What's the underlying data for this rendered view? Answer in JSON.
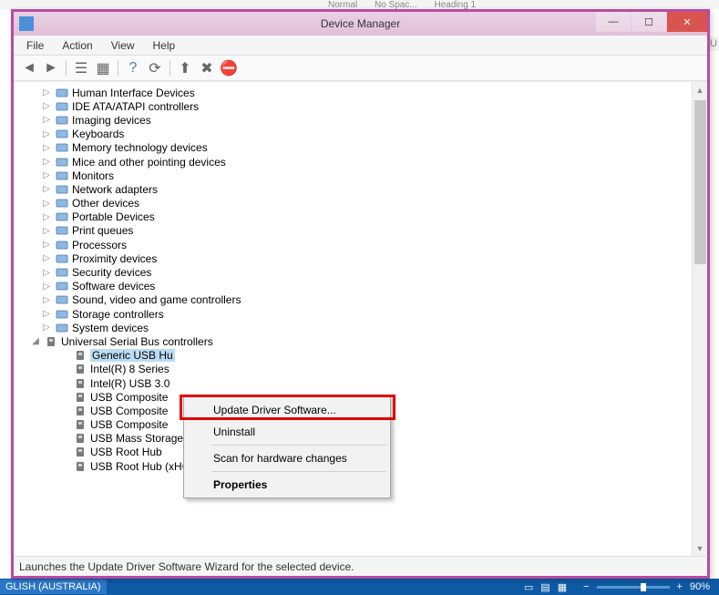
{
  "background": {
    "ribbon_fragments": [
      "Normal",
      "No Spac...",
      "Heading 1"
    ],
    "lang": "GLISH (AUSTRALIA)",
    "zoom": "90%",
    "su_frag": "SU"
  },
  "window": {
    "title": "Device Manager"
  },
  "menubar": {
    "file": "File",
    "action": "Action",
    "view": "View",
    "help": "Help"
  },
  "tree": {
    "items": [
      {
        "label": "Human Interface Devices",
        "icon": "hid"
      },
      {
        "label": "IDE ATA/ATAPI controllers",
        "icon": "ide"
      },
      {
        "label": "Imaging devices",
        "icon": "imaging"
      },
      {
        "label": "Keyboards",
        "icon": "keyboard"
      },
      {
        "label": "Memory technology devices",
        "icon": "memory"
      },
      {
        "label": "Mice and other pointing devices",
        "icon": "mouse"
      },
      {
        "label": "Monitors",
        "icon": "monitor"
      },
      {
        "label": "Network adapters",
        "icon": "network"
      },
      {
        "label": "Other devices",
        "icon": "other"
      },
      {
        "label": "Portable Devices",
        "icon": "portable"
      },
      {
        "label": "Print queues",
        "icon": "printer"
      },
      {
        "label": "Processors",
        "icon": "cpu"
      },
      {
        "label": "Proximity devices",
        "icon": "prox"
      },
      {
        "label": "Security devices",
        "icon": "security"
      },
      {
        "label": "Software devices",
        "icon": "software"
      },
      {
        "label": "Sound, video and game controllers",
        "icon": "sound"
      },
      {
        "label": "Storage controllers",
        "icon": "storage"
      },
      {
        "label": "System devices",
        "icon": "system"
      }
    ],
    "usb_parent": "Universal Serial Bus controllers",
    "usb_children": [
      "Generic USB Hu",
      "Intel(R) 8 Series",
      "Intel(R) USB 3.0",
      "USB Composite",
      "USB Composite",
      "USB Composite",
      "USB Mass Storage Device",
      "USB Root Hub",
      "USB Root Hub (xHCI)"
    ]
  },
  "context_menu": {
    "update": "Update Driver Software...",
    "uninstall": "Uninstall",
    "scan": "Scan for hardware changes",
    "properties": "Properties"
  },
  "statusbar": {
    "text": "Launches the Update Driver Software Wizard for the selected device."
  }
}
